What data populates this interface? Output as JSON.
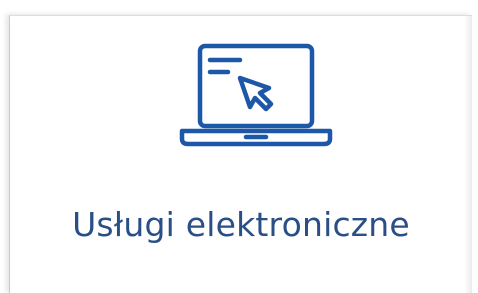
{
  "tile": {
    "label": "Usługi elektroniczne",
    "icon": "laptop-cursor-icon"
  },
  "colors": {
    "icon": "#1d57a8",
    "label": "#2a4f86",
    "background": "#ffffff"
  }
}
